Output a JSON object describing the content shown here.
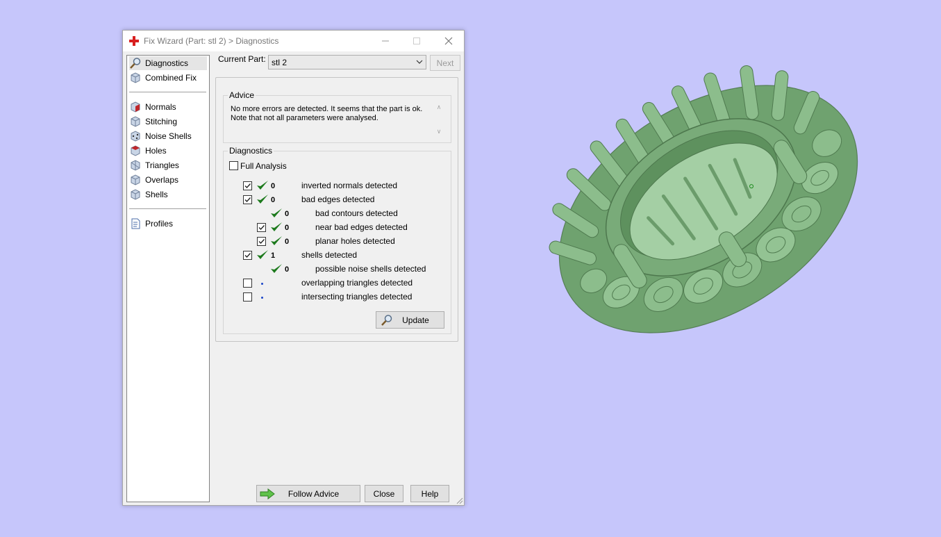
{
  "window": {
    "title": "Fix Wizard (Part: stl 2) > Diagnostics",
    "controls": [
      "minimize",
      "maximize",
      "close"
    ]
  },
  "nav": {
    "items": [
      {
        "label": "Diagnostics",
        "icon": "magnifier-icon",
        "selected": true
      },
      {
        "label": "Combined Fix",
        "icon": "cube-icon"
      },
      {
        "label": "Normals",
        "icon": "cube-icon"
      },
      {
        "label": "Stitching",
        "icon": "cube-icon"
      },
      {
        "label": "Noise Shells",
        "icon": "cube-icon"
      },
      {
        "label": "Holes",
        "icon": "cube-icon"
      },
      {
        "label": "Triangles",
        "icon": "cube-icon"
      },
      {
        "label": "Overlaps",
        "icon": "cube-icon"
      },
      {
        "label": "Shells",
        "icon": "cube-icon"
      },
      {
        "label": "Profiles",
        "icon": "document-icon"
      }
    ]
  },
  "header": {
    "current_part_label": "Current Part:",
    "current_part_value": "stl 2",
    "next_label": "Next"
  },
  "advice": {
    "title": "Advice",
    "text": "No more errors are detected. It seems that the part is ok. Note that not all parameters were analysed."
  },
  "diagnostics": {
    "title": "Diagnostics",
    "full_analysis_label": "Full Analysis",
    "full_analysis_checked": false,
    "rows": [
      {
        "checked": true,
        "status": "ok",
        "count": "0",
        "label": "inverted normals detected"
      },
      {
        "checked": true,
        "status": "ok",
        "count": "0",
        "label": "bad edges detected"
      },
      {
        "checked": null,
        "status": "ok",
        "count": "0",
        "label": "bad contours detected"
      },
      {
        "checked": true,
        "status": "ok",
        "count": "0",
        "label": "near bad edges detected"
      },
      {
        "checked": true,
        "status": "ok",
        "count": "0",
        "label": "planar holes detected"
      },
      {
        "checked": true,
        "status": "ok",
        "count": "1",
        "label": "shells detected"
      },
      {
        "checked": null,
        "status": "ok",
        "count": "0",
        "label": "possible noise shells detected"
      },
      {
        "checked": false,
        "status": "not-analysed",
        "count": "",
        "label": "overlapping triangles detected"
      },
      {
        "checked": false,
        "status": "not-analysed",
        "count": "",
        "label": "intersecting triangles detected"
      }
    ],
    "update_label": "Update"
  },
  "footer": {
    "follow_advice_label": "Follow Advice",
    "close_label": "Close",
    "help_label": "Help"
  },
  "colors": {
    "background": "#c6c6fb",
    "model_green": "#7fb07f",
    "check_green": "#1d7a1d",
    "app_icon_red": "#d81f1f"
  }
}
